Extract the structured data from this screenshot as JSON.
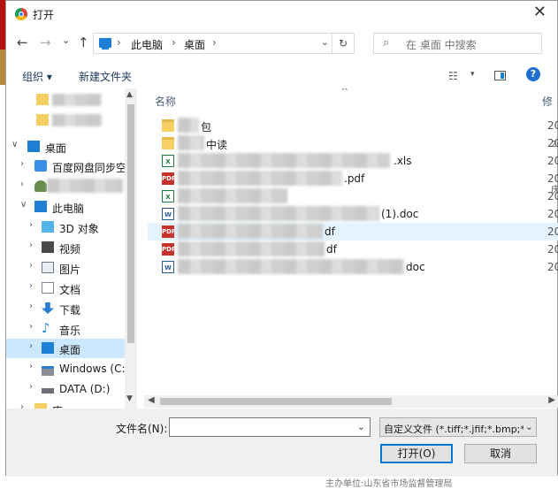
{
  "title": "打开",
  "close_glyph": "✕",
  "nav": {
    "back": "←",
    "forward": "→",
    "recent": "⌄",
    "up": "↑"
  },
  "address": {
    "seg1": "此电脑",
    "seg2": "桌面",
    "sep": "›",
    "dropdown": "⌄",
    "refresh": "↻"
  },
  "search": {
    "placeholder": "在 桌面 中搜索",
    "icon": "⌕"
  },
  "toolbar": {
    "organize": "组织 ▾",
    "new_folder": "新建文件夹",
    "view_glyph": "☷",
    "view_dd": "▾",
    "help": "?"
  },
  "sidebar": {
    "items": [
      {
        "chev": "∨",
        "label": "桌面"
      },
      {
        "chev": "›",
        "label": "百度网盘同步空间"
      },
      {
        "chev": "›",
        "label": ""
      },
      {
        "chev": "∨",
        "label": "此电脑"
      },
      {
        "chev": "›",
        "label": "3D 对象"
      },
      {
        "chev": "›",
        "label": "视频"
      },
      {
        "chev": "›",
        "label": "图片"
      },
      {
        "chev": "›",
        "label": "文档"
      },
      {
        "chev": "›",
        "label": "下载"
      },
      {
        "chev": "›",
        "label": "音乐"
      },
      {
        "chev": "›",
        "label": "桌面"
      },
      {
        "chev": "›",
        "label": "Windows (C:)"
      },
      {
        "chev": "›",
        "label": "DATA (D:)"
      },
      {
        "chev": "›",
        "label": "库"
      }
    ]
  },
  "files": {
    "col_name": "名称",
    "col_date": "修",
    "sort_caret": "^",
    "rows": [
      {
        "icon": "",
        "name": "包",
        "date": "20"
      },
      {
        "icon": "",
        "name": "中读",
        "date": "20"
      },
      {
        "icon": "X",
        "name": ".xls",
        "date": "20"
      },
      {
        "icon": "PDF",
        "name": ".pdf",
        "date": "20"
      },
      {
        "icon": "X",
        "name": "",
        "date": "20"
      },
      {
        "icon": "W",
        "name": "(1).doc",
        "date": "20"
      },
      {
        "icon": "PDF",
        "name": "df",
        "date": "20"
      },
      {
        "icon": "PDF",
        "name": "df",
        "date": "20"
      },
      {
        "icon": "W",
        "name": "doc",
        "date": "20"
      }
    ]
  },
  "filename": {
    "label": "文件名(N):",
    "value": "",
    "dropdown": "⌄"
  },
  "filter": {
    "text": "自定义文件 (*.tiff;*.jfif;*.bmp;*.",
    "dropdown": "⌄"
  },
  "buttons": {
    "open": "打开(O)",
    "cancel": "取消"
  },
  "scroll": {
    "up": "▲",
    "down": "▼",
    "left": "◀",
    "right": "▶"
  },
  "background": {
    "below_text": "主办单位:山东省市场监督管理局",
    "right_text1": "2(",
    "right_text2": "庆"
  },
  "colors": {
    "selection": "#cce8ff",
    "hover": "#e5f3ff",
    "accent": "#0078d7",
    "brand_red": "#b5120f"
  }
}
